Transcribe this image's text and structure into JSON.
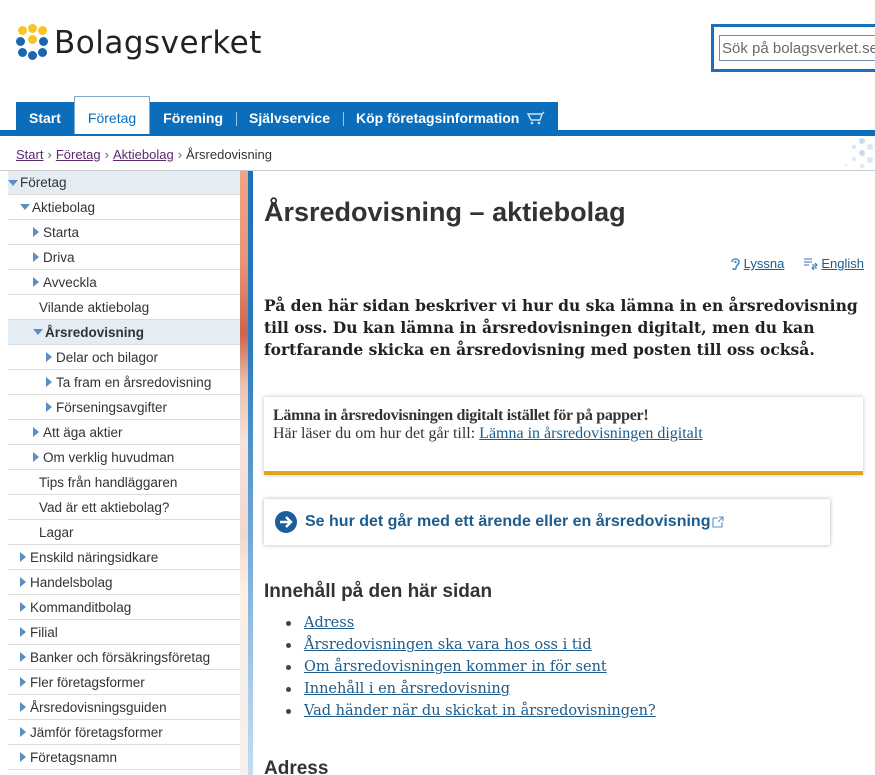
{
  "header": {
    "logo_text": "Bolagsverket",
    "search_placeholder": "Sök på bolagsverket.se"
  },
  "nav": {
    "items": [
      {
        "label": "Start",
        "active": false
      },
      {
        "label": "Företag",
        "active": true
      },
      {
        "label": "Förening",
        "active": false
      },
      {
        "label": "Självservice",
        "active": false
      },
      {
        "label": "Köp företagsinformation",
        "active": false,
        "icon": "cart-icon"
      }
    ]
  },
  "breadcrumb": {
    "links": [
      "Start",
      "Företag",
      "Aktiebolag"
    ],
    "current": "Årsredovisning",
    "separator": "›"
  },
  "sidebar": {
    "items": [
      {
        "label": "Företag",
        "expanded": true,
        "level": 0
      },
      {
        "label": "Aktiebolag",
        "expanded": true,
        "level": 1
      },
      {
        "label": "Starta",
        "level": 2
      },
      {
        "label": "Driva",
        "level": 2
      },
      {
        "label": "Avveckla",
        "level": 2
      },
      {
        "label": "Vilande aktiebolag",
        "level": 2
      },
      {
        "label": "Årsredovisning",
        "expanded": true,
        "level": 2,
        "current": true
      },
      {
        "label": "Delar och bilagor",
        "level": 3
      },
      {
        "label": "Ta fram en årsredovisning",
        "level": 3
      },
      {
        "label": "Förseningsavgifter",
        "level": 3
      },
      {
        "label": "Att äga aktier",
        "level": 2
      },
      {
        "label": "Om verklig huvudman",
        "level": 2
      },
      {
        "label": "Tips från handläggaren",
        "level": 2
      },
      {
        "label": "Vad är ett aktiebolag?",
        "level": 2
      },
      {
        "label": "Lagar",
        "level": 2
      },
      {
        "label": "Enskild näringsidkare",
        "level": 1
      },
      {
        "label": "Handelsbolag",
        "level": 1
      },
      {
        "label": "Kommanditbolag",
        "level": 1
      },
      {
        "label": "Filial",
        "level": 1
      },
      {
        "label": "Banker och försäkringsföretag",
        "level": 1
      },
      {
        "label": "Fler företagsformer",
        "level": 1
      },
      {
        "label": "Årsredovisningsguiden",
        "level": 1
      },
      {
        "label": "Jämför företagsformer",
        "level": 1
      },
      {
        "label": "Företagsnamn",
        "level": 1
      }
    ]
  },
  "main": {
    "title": "Årsredovisning – aktiebolag",
    "tools": {
      "listen": "Lyssna",
      "english": "English"
    },
    "lead": "På den här sidan beskriver vi hur du ska lämna in en årsredovisning till oss. Du kan lämna in årsredovisningen digitalt, men du kan fortfarande skicka en årsredovisning med posten till oss också.",
    "notice": {
      "title": "Lämna in årsredovisningen digitalt istället för på papper!",
      "text": "Här läser du om hur det går till: ",
      "link": "Lämna in årsredovisningen digitalt"
    },
    "cta": "Se hur det går med ett ärende eller en årsredovisning",
    "toc_title": "Innehåll på den här sidan",
    "toc": [
      "Adress",
      "Årsredovisningen ska vara hos oss i tid",
      "Om årsredovisningen kommer in för sent",
      "Innehåll i en årsredovisning",
      "Vad händer när du skickat in årsredovisningen?"
    ],
    "section_title": "Adress"
  },
  "colors": {
    "brand_blue": "#0a6ebd",
    "link": "#1d5c8d",
    "visited_link": "#5b2a6e",
    "notice_accent": "#e0a422",
    "logo_yellow": "#f7c428",
    "logo_blue": "#1a66b0"
  }
}
